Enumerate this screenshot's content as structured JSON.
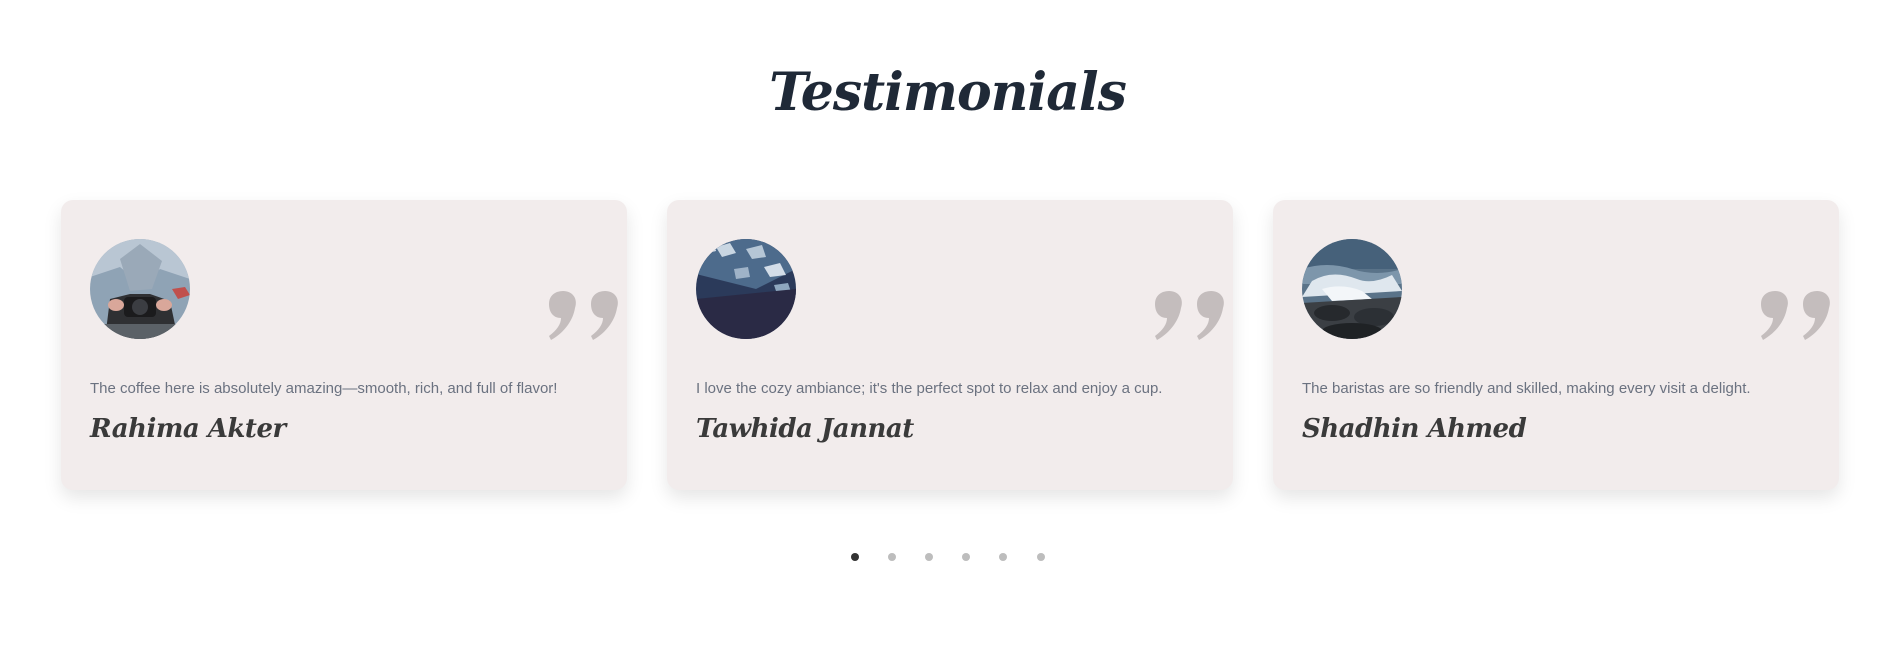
{
  "section": {
    "title": "Testimonials"
  },
  "testimonials": [
    {
      "text": "The coffee here is absolutely amazing—smooth, rich, and full of flavor!",
      "name": "Rahima Akter",
      "avatar_icon": "person-with-camera-photo"
    },
    {
      "text": "I love the cozy ambiance; it's the perfect spot to relax and enjoy a cup.",
      "name": "Tawhida Jannat",
      "avatar_icon": "dark-blue-water-photo"
    },
    {
      "text": "The baristas are so friendly and skilled, making every visit a delight.",
      "name": "Shadhin Ahmed",
      "avatar_icon": "ocean-waves-rocks-photo"
    }
  ],
  "pagination": {
    "count": 6,
    "active_index": 0
  },
  "colors": {
    "heading": "#1f2937",
    "card_bg": "#f2ecec",
    "quote_mark": "#c4bdbd",
    "dot_active": "#333333",
    "dot_inactive": "#bdbdbd"
  }
}
